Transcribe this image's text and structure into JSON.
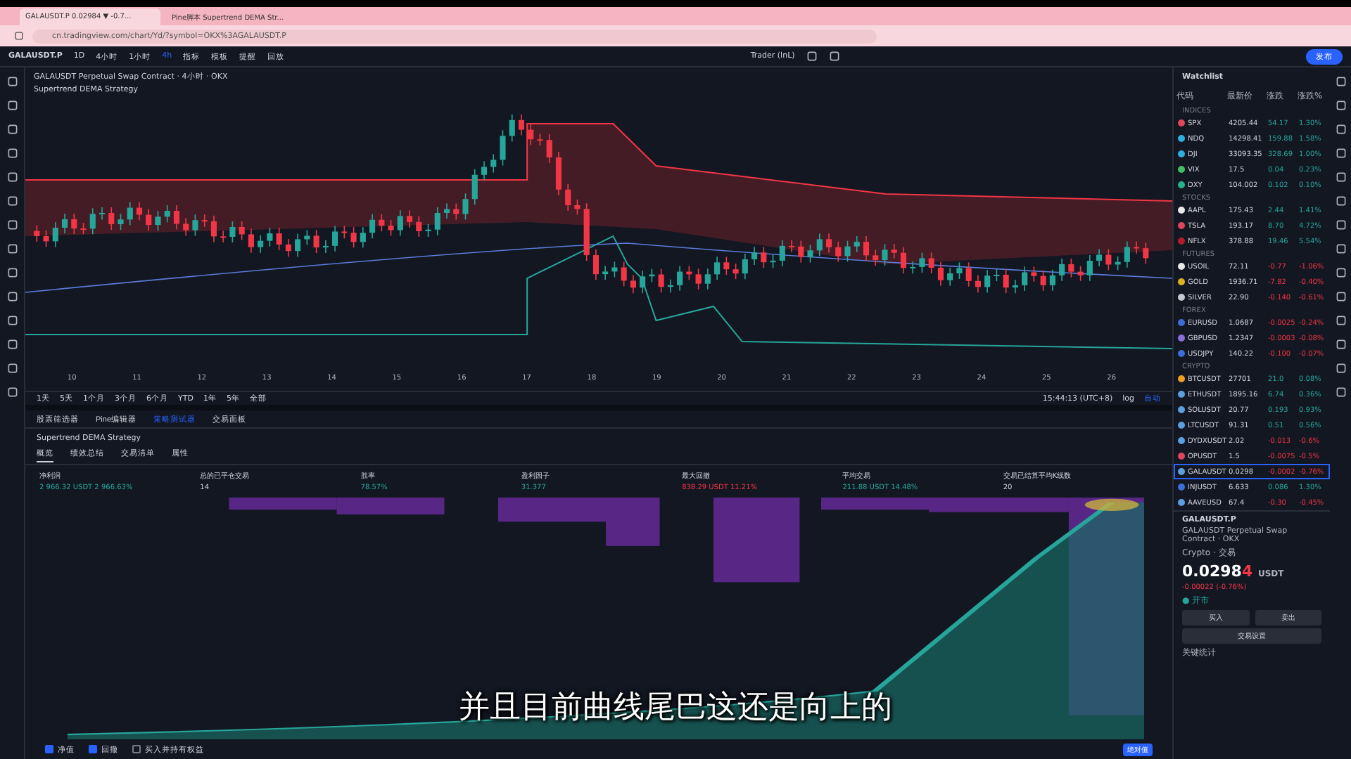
{
  "browser": {
    "tabs": [
      {
        "title": "GALAUSDT.P 0.02984 ▼ -0.7...",
        "selected": true
      },
      {
        "title": "Pine脚本 Supertrend DEMA Str...",
        "selected": false
      }
    ],
    "url": "cn.tradingview.com/chart/Yd/?symbol=OKX%3AGALAUSDT.P"
  },
  "toolbar": {
    "symbol": "GALAUSDT.P",
    "intervals": [
      {
        "label": "1D",
        "selected": false
      },
      {
        "label": "4小时",
        "selected": false
      },
      {
        "label": "1小时",
        "selected": false
      },
      {
        "label": "4h",
        "selected": true
      }
    ],
    "items": [
      "指标",
      "模板",
      "提醒",
      "回放"
    ],
    "account": "Trader (lnL)",
    "publish": "发布"
  },
  "chart": {
    "title": "GALAUSDT Perpetual Swap Contract · 4小时 · OKX",
    "strategy": "Supertrend DEMA Strategy",
    "dates": [
      "10",
      "11",
      "12",
      "13",
      "14",
      "15",
      "16",
      "17",
      "18",
      "19",
      "20",
      "21",
      "22",
      "23",
      "24",
      "25",
      "26"
    ],
    "ranges": [
      "1天",
      "5天",
      "1个月",
      "3个月",
      "6个月",
      "YTD",
      "1年",
      "5年",
      "全部"
    ],
    "time": "15:44:13 (UTC+8)",
    "log": "log",
    "auto": "自动"
  },
  "panel": {
    "tabs": [
      {
        "label": "股票筛选器",
        "selected": false
      },
      {
        "label": "Pine编辑器",
        "selected": false
      },
      {
        "label": "策略测试器",
        "selected": true
      },
      {
        "label": "交易面板",
        "selected": false
      }
    ],
    "strategy": "Supertrend DEMA Strategy",
    "subtabs": [
      {
        "label": "概览",
        "selected": true
      },
      {
        "label": "绩效总结",
        "selected": false
      },
      {
        "label": "交易清单",
        "selected": false
      },
      {
        "label": "属性",
        "selected": false
      }
    ],
    "metrics": [
      {
        "label": "净利润",
        "value": "2 966.32 USDT  2 966.63%",
        "color": "#26a69a"
      },
      {
        "label": "总的已平仓交易",
        "value": "14",
        "color": "#d1d4dc"
      },
      {
        "label": "胜率",
        "value": "78.57%",
        "color": "#26a69a"
      },
      {
        "label": "盈利因子",
        "value": "31.377",
        "color": "#26a69a"
      },
      {
        "label": "最大回撤",
        "value": "838.29 USDT  11.21%",
        "color": "#f23645"
      },
      {
        "label": "平均交易",
        "value": "211.88 USDT  14.48%",
        "color": "#26a69a"
      },
      {
        "label": "交易已结算平均K线数",
        "value": "20",
        "color": "#d1d4dc"
      }
    ],
    "toggles": [
      {
        "label": "净值",
        "checked": true
      },
      {
        "label": "回撤",
        "checked": true
      },
      {
        "label": "买入并持有权益",
        "checked": false
      }
    ],
    "modes": [
      {
        "label": "绝对值",
        "selected": true
      }
    ]
  },
  "watchlist": {
    "title": "Watchlist",
    "columns": [
      "代码",
      "最新价",
      "涨跌",
      "涨跌%"
    ],
    "sections": [
      {
        "title": "INDICES",
        "rows": [
          {
            "symbol": "SPX",
            "price": "4205.44",
            "change": "54.17",
            "percent": "1.30%",
            "negative": false,
            "color": "#e0455a",
            "selected": false
          },
          {
            "symbol": "NDQ",
            "price": "14298.41",
            "change": "159.88",
            "percent": "1.58%",
            "negative": false,
            "color": "#2eaee0",
            "selected": false
          },
          {
            "symbol": "DJI",
            "price": "33093.35",
            "change": "328.69",
            "percent": "1.00%",
            "negative": false,
            "color": "#2eaee0",
            "selected": false
          },
          {
            "symbol": "VIX",
            "price": "17.5",
            "change": "0.04",
            "percent": "0.23%",
            "negative": false,
            "color": "#3fbf5f",
            "selected": false
          },
          {
            "symbol": "DXY",
            "price": "104.002",
            "change": "0.102",
            "percent": "0.10%",
            "negative": false,
            "color": "#26b38a",
            "selected": false
          }
        ]
      },
      {
        "title": "STOCKS",
        "rows": [
          {
            "symbol": "AAPL",
            "price": "175.43",
            "change": "2.44",
            "percent": "1.41%",
            "negative": false,
            "color": "#e8e8e8",
            "selected": false
          },
          {
            "symbol": "TSLA",
            "price": "193.17",
            "change": "8.70",
            "percent": "4.72%",
            "negative": false,
            "color": "#e0455a",
            "selected": false
          },
          {
            "symbol": "NFLX",
            "price": "378.88",
            "change": "19.46",
            "percent": "5.54%",
            "negative": false,
            "color": "#b51c2a",
            "selected": false
          }
        ]
      },
      {
        "title": "FUTURES",
        "rows": [
          {
            "symbol": "USOIL",
            "price": "72.11",
            "change": "-0.77",
            "percent": "-1.06%",
            "negative": true,
            "color": "#e8e8e8",
            "selected": false
          },
          {
            "symbol": "GOLD",
            "price": "1936.71",
            "change": "-7.82",
            "percent": "-0.40%",
            "negative": true,
            "color": "#e0b020",
            "selected": false
          },
          {
            "symbol": "SILVER",
            "price": "22.90",
            "change": "-0.140",
            "percent": "-0.61%",
            "negative": true,
            "color": "#c8c8d0",
            "selected": false
          }
        ]
      },
      {
        "title": "FOREX",
        "rows": [
          {
            "symbol": "EURUSD",
            "price": "1.0687",
            "change": "-0.0025",
            "percent": "-0.24%",
            "negative": true,
            "color": "#3a6fd8",
            "selected": false
          },
          {
            "symbol": "GBPUSD",
            "price": "1.2347",
            "change": "-0.0003",
            "percent": "-0.08%",
            "negative": true,
            "color": "#8a6fd8",
            "selected": false
          },
          {
            "symbol": "USDJPY",
            "price": "140.22",
            "change": "-0.100",
            "percent": "-0.07%",
            "negative": true,
            "color": "#3a6fd8",
            "selected": false
          }
        ]
      },
      {
        "title": "CRYPTO",
        "rows": [
          {
            "symbol": "BTCUSDT",
            "price": "27701",
            "change": "21.0",
            "percent": "0.08%",
            "negative": false,
            "color": "#f0a020",
            "selected": false
          },
          {
            "symbol": "ETHUSDT",
            "price": "1895.16",
            "change": "6.74",
            "percent": "0.36%",
            "negative": false,
            "color": "#5aa0e0",
            "selected": false
          },
          {
            "symbol": "SOLUSDT",
            "price": "20.77",
            "change": "0.193",
            "percent": "0.93%",
            "negative": false,
            "color": "#5aa0e0",
            "selected": false
          },
          {
            "symbol": "LTCUSDT",
            "price": "91.31",
            "change": "0.51",
            "percent": "0.56%",
            "negative": false,
            "color": "#5aa0e0",
            "selected": false
          },
          {
            "symbol": "DYDXUSDT",
            "price": "2.02",
            "change": "-0.013",
            "percent": "-0.6%",
            "negative": true,
            "color": "#5aa0e0",
            "selected": false
          },
          {
            "symbol": "OPUSDT",
            "price": "1.5",
            "change": "-0.0075",
            "percent": "-0.5%",
            "negative": true,
            "color": "#e0455a",
            "selected": false
          },
          {
            "symbol": "GALAUSDT",
            "price": "0.0298",
            "change": "-0.0002",
            "percent": "-0.76%",
            "negative": true,
            "color": "#5aa0e0",
            "selected": true
          },
          {
            "symbol": "INJUSDT",
            "price": "6.633",
            "change": "0.086",
            "percent": "1.30%",
            "negative": false,
            "color": "#3a6fd8",
            "selected": false
          },
          {
            "symbol": "AAVEUSD",
            "price": "67.4",
            "change": "-0.30",
            "percent": "-0.45%",
            "negative": true,
            "color": "#5aa0e0",
            "selected": false
          }
        ]
      }
    ],
    "detail": {
      "symbol": "GALAUSDT.P",
      "name": "GALAUSDT Perpetual Swap Contract · OKX",
      "type": "Crypto · 交易",
      "price_main": "0.0298",
      "price_last": "4",
      "currency": "USDT",
      "change": "-0.00022 (-0.76%)",
      "status": "● 开市",
      "buttons": [
        "买入",
        "卖出"
      ],
      "setting": "交易设置",
      "section": "关键统计"
    }
  },
  "subtitle": "并且目前曲线尾巴这还是向上的"
}
